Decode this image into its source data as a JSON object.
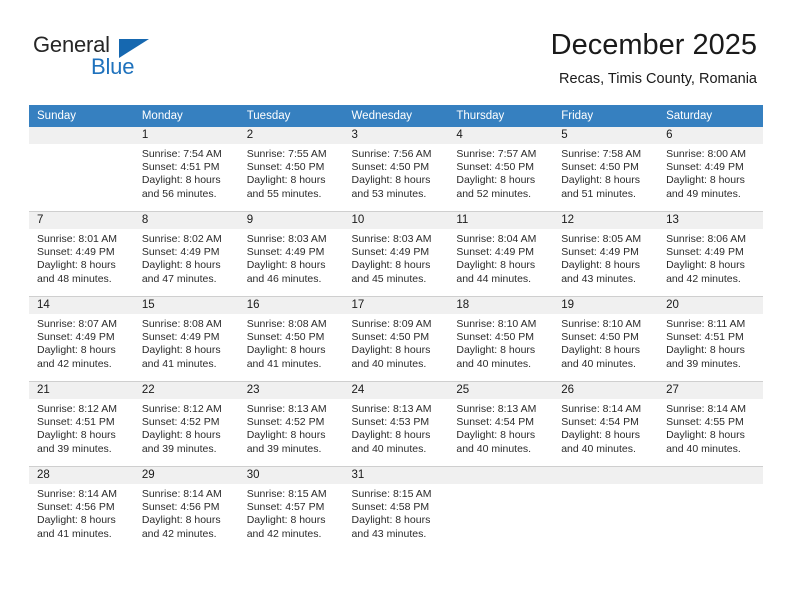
{
  "brand": {
    "name_top": "General",
    "name_bottom": "Blue",
    "accent_color": "#1668b0",
    "text_color": "#262626"
  },
  "header": {
    "title": "December 2025",
    "subtitle": "Recas, Timis County, Romania"
  },
  "theme": {
    "header_row_bg": "#3680c0",
    "header_row_text": "#ffffff",
    "daynum_bg": "#f0f0f0",
    "cell_border": "#cfcfcf",
    "page_bg": "#ffffff"
  },
  "calendar": {
    "weekday_headers": [
      "Sunday",
      "Monday",
      "Tuesday",
      "Wednesday",
      "Thursday",
      "Friday",
      "Saturday"
    ],
    "labels": {
      "sunrise": "Sunrise:",
      "sunset": "Sunset:",
      "daylight": "Daylight:"
    },
    "weeks": [
      [
        {
          "day": "",
          "empty": true,
          "sunrise": "",
          "sunset": "",
          "daylight_line1": "",
          "daylight_line2": ""
        },
        {
          "day": "1",
          "sunrise": "Sunrise: 7:54 AM",
          "sunset": "Sunset: 4:51 PM",
          "daylight_line1": "Daylight: 8 hours",
          "daylight_line2": "and 56 minutes."
        },
        {
          "day": "2",
          "sunrise": "Sunrise: 7:55 AM",
          "sunset": "Sunset: 4:50 PM",
          "daylight_line1": "Daylight: 8 hours",
          "daylight_line2": "and 55 minutes."
        },
        {
          "day": "3",
          "sunrise": "Sunrise: 7:56 AM",
          "sunset": "Sunset: 4:50 PM",
          "daylight_line1": "Daylight: 8 hours",
          "daylight_line2": "and 53 minutes."
        },
        {
          "day": "4",
          "sunrise": "Sunrise: 7:57 AM",
          "sunset": "Sunset: 4:50 PM",
          "daylight_line1": "Daylight: 8 hours",
          "daylight_line2": "and 52 minutes."
        },
        {
          "day": "5",
          "sunrise": "Sunrise: 7:58 AM",
          "sunset": "Sunset: 4:50 PM",
          "daylight_line1": "Daylight: 8 hours",
          "daylight_line2": "and 51 minutes."
        },
        {
          "day": "6",
          "sunrise": "Sunrise: 8:00 AM",
          "sunset": "Sunset: 4:49 PM",
          "daylight_line1": "Daylight: 8 hours",
          "daylight_line2": "and 49 minutes."
        }
      ],
      [
        {
          "day": "7",
          "sunrise": "Sunrise: 8:01 AM",
          "sunset": "Sunset: 4:49 PM",
          "daylight_line1": "Daylight: 8 hours",
          "daylight_line2": "and 48 minutes."
        },
        {
          "day": "8",
          "sunrise": "Sunrise: 8:02 AM",
          "sunset": "Sunset: 4:49 PM",
          "daylight_line1": "Daylight: 8 hours",
          "daylight_line2": "and 47 minutes."
        },
        {
          "day": "9",
          "sunrise": "Sunrise: 8:03 AM",
          "sunset": "Sunset: 4:49 PM",
          "daylight_line1": "Daylight: 8 hours",
          "daylight_line2": "and 46 minutes."
        },
        {
          "day": "10",
          "sunrise": "Sunrise: 8:03 AM",
          "sunset": "Sunset: 4:49 PM",
          "daylight_line1": "Daylight: 8 hours",
          "daylight_line2": "and 45 minutes."
        },
        {
          "day": "11",
          "sunrise": "Sunrise: 8:04 AM",
          "sunset": "Sunset: 4:49 PM",
          "daylight_line1": "Daylight: 8 hours",
          "daylight_line2": "and 44 minutes."
        },
        {
          "day": "12",
          "sunrise": "Sunrise: 8:05 AM",
          "sunset": "Sunset: 4:49 PM",
          "daylight_line1": "Daylight: 8 hours",
          "daylight_line2": "and 43 minutes."
        },
        {
          "day": "13",
          "sunrise": "Sunrise: 8:06 AM",
          "sunset": "Sunset: 4:49 PM",
          "daylight_line1": "Daylight: 8 hours",
          "daylight_line2": "and 42 minutes."
        }
      ],
      [
        {
          "day": "14",
          "sunrise": "Sunrise: 8:07 AM",
          "sunset": "Sunset: 4:49 PM",
          "daylight_line1": "Daylight: 8 hours",
          "daylight_line2": "and 42 minutes."
        },
        {
          "day": "15",
          "sunrise": "Sunrise: 8:08 AM",
          "sunset": "Sunset: 4:49 PM",
          "daylight_line1": "Daylight: 8 hours",
          "daylight_line2": "and 41 minutes."
        },
        {
          "day": "16",
          "sunrise": "Sunrise: 8:08 AM",
          "sunset": "Sunset: 4:50 PM",
          "daylight_line1": "Daylight: 8 hours",
          "daylight_line2": "and 41 minutes."
        },
        {
          "day": "17",
          "sunrise": "Sunrise: 8:09 AM",
          "sunset": "Sunset: 4:50 PM",
          "daylight_line1": "Daylight: 8 hours",
          "daylight_line2": "and 40 minutes."
        },
        {
          "day": "18",
          "sunrise": "Sunrise: 8:10 AM",
          "sunset": "Sunset: 4:50 PM",
          "daylight_line1": "Daylight: 8 hours",
          "daylight_line2": "and 40 minutes."
        },
        {
          "day": "19",
          "sunrise": "Sunrise: 8:10 AM",
          "sunset": "Sunset: 4:50 PM",
          "daylight_line1": "Daylight: 8 hours",
          "daylight_line2": "and 40 minutes."
        },
        {
          "day": "20",
          "sunrise": "Sunrise: 8:11 AM",
          "sunset": "Sunset: 4:51 PM",
          "daylight_line1": "Daylight: 8 hours",
          "daylight_line2": "and 39 minutes."
        }
      ],
      [
        {
          "day": "21",
          "sunrise": "Sunrise: 8:12 AM",
          "sunset": "Sunset: 4:51 PM",
          "daylight_line1": "Daylight: 8 hours",
          "daylight_line2": "and 39 minutes."
        },
        {
          "day": "22",
          "sunrise": "Sunrise: 8:12 AM",
          "sunset": "Sunset: 4:52 PM",
          "daylight_line1": "Daylight: 8 hours",
          "daylight_line2": "and 39 minutes."
        },
        {
          "day": "23",
          "sunrise": "Sunrise: 8:13 AM",
          "sunset": "Sunset: 4:52 PM",
          "daylight_line1": "Daylight: 8 hours",
          "daylight_line2": "and 39 minutes."
        },
        {
          "day": "24",
          "sunrise": "Sunrise: 8:13 AM",
          "sunset": "Sunset: 4:53 PM",
          "daylight_line1": "Daylight: 8 hours",
          "daylight_line2": "and 40 minutes."
        },
        {
          "day": "25",
          "sunrise": "Sunrise: 8:13 AM",
          "sunset": "Sunset: 4:54 PM",
          "daylight_line1": "Daylight: 8 hours",
          "daylight_line2": "and 40 minutes."
        },
        {
          "day": "26",
          "sunrise": "Sunrise: 8:14 AM",
          "sunset": "Sunset: 4:54 PM",
          "daylight_line1": "Daylight: 8 hours",
          "daylight_line2": "and 40 minutes."
        },
        {
          "day": "27",
          "sunrise": "Sunrise: 8:14 AM",
          "sunset": "Sunset: 4:55 PM",
          "daylight_line1": "Daylight: 8 hours",
          "daylight_line2": "and 40 minutes."
        }
      ],
      [
        {
          "day": "28",
          "sunrise": "Sunrise: 8:14 AM",
          "sunset": "Sunset: 4:56 PM",
          "daylight_line1": "Daylight: 8 hours",
          "daylight_line2": "and 41 minutes."
        },
        {
          "day": "29",
          "sunrise": "Sunrise: 8:14 AM",
          "sunset": "Sunset: 4:56 PM",
          "daylight_line1": "Daylight: 8 hours",
          "daylight_line2": "and 42 minutes."
        },
        {
          "day": "30",
          "sunrise": "Sunrise: 8:15 AM",
          "sunset": "Sunset: 4:57 PM",
          "daylight_line1": "Daylight: 8 hours",
          "daylight_line2": "and 42 minutes."
        },
        {
          "day": "31",
          "sunrise": "Sunrise: 8:15 AM",
          "sunset": "Sunset: 4:58 PM",
          "daylight_line1": "Daylight: 8 hours",
          "daylight_line2": "and 43 minutes."
        },
        {
          "day": "",
          "empty": true,
          "sunrise": "",
          "sunset": "",
          "daylight_line1": "",
          "daylight_line2": ""
        },
        {
          "day": "",
          "empty": true,
          "sunrise": "",
          "sunset": "",
          "daylight_line1": "",
          "daylight_line2": ""
        },
        {
          "day": "",
          "empty": true,
          "sunrise": "",
          "sunset": "",
          "daylight_line1": "",
          "daylight_line2": ""
        }
      ]
    ]
  }
}
